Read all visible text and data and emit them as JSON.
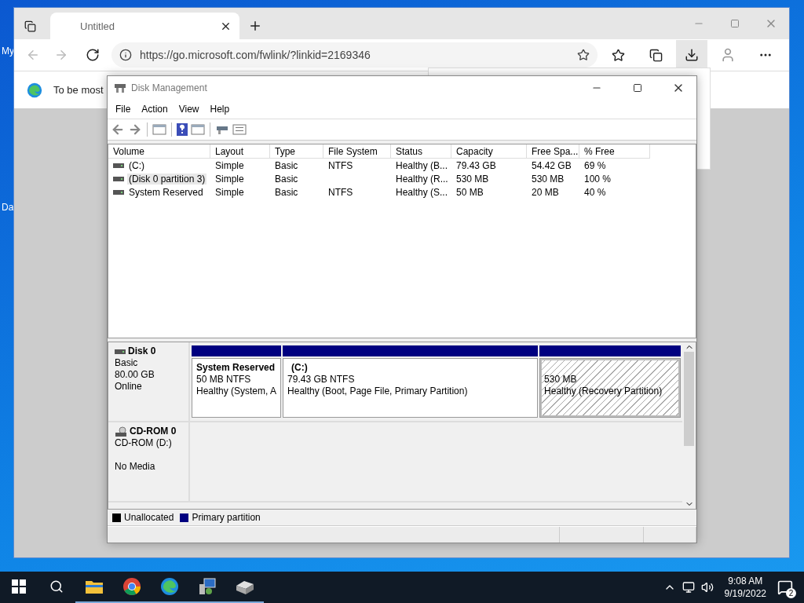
{
  "desktop": {
    "icon_labels": [
      "My",
      "Da"
    ]
  },
  "browser": {
    "tab": {
      "title": "Untitled",
      "selected": true
    },
    "url": "https://go.microsoft.com/fwlink/?linkid=2169346",
    "info_bar": "To be most"
  },
  "window": {
    "title": "Disk Management",
    "menu": [
      "File",
      "Action",
      "View",
      "Help"
    ],
    "volumes": {
      "columns": [
        "Volume",
        "Layout",
        "Type",
        "File System",
        "Status",
        "Capacity",
        "Free Spa...",
        "% Free"
      ],
      "rows": [
        {
          "cells": [
            "(C:)",
            "Simple",
            "Basic",
            "NTFS",
            "Healthy (B...",
            "79.43 GB",
            "54.42 GB",
            "69 %"
          ],
          "selected": false
        },
        {
          "cells": [
            "(Disk 0 partition 3)",
            "Simple",
            "Basic",
            "",
            "Healthy (R...",
            "530 MB",
            "530 MB",
            "100 %"
          ],
          "selected": true
        },
        {
          "cells": [
            "System Reserved",
            "Simple",
            "Basic",
            "NTFS",
            "Healthy (S...",
            "50 MB",
            "20 MB",
            "40 %"
          ],
          "selected": false
        }
      ]
    },
    "disks": [
      {
        "kind": "disk",
        "name": "Disk 0",
        "type": "Basic",
        "size": "80.00 GB",
        "status": "Online",
        "partitions": [
          {
            "title": "System Reserved",
            "size": "50 MB NTFS",
            "status": "Healthy (System, A",
            "selected": false
          },
          {
            "title": "(C:)",
            "size": "79.43 GB NTFS",
            "status": "Healthy (Boot, Page File, Primary Partition)",
            "selected": false
          },
          {
            "size": "530 MB",
            "status": "Healthy (Recovery Partition)",
            "selected": true
          }
        ]
      },
      {
        "kind": "cdrom",
        "name": "CD-ROM 0",
        "type": "CD-ROM (D:)",
        "status": "No Media"
      }
    ],
    "legend": [
      {
        "label": "Unallocated",
        "color": "#000000"
      },
      {
        "label": "Primary partition",
        "color": "#000080"
      }
    ]
  },
  "taskbar": {
    "apps": [
      {
        "kind": "folder",
        "running": true
      },
      {
        "kind": "chrome",
        "running": true
      },
      {
        "kind": "edge",
        "running": true
      },
      {
        "kind": "tool",
        "running": true
      },
      {
        "kind": "disk",
        "running": true
      }
    ],
    "time": "9:08 AM",
    "date": "9/19/2022",
    "notifications": "2"
  }
}
